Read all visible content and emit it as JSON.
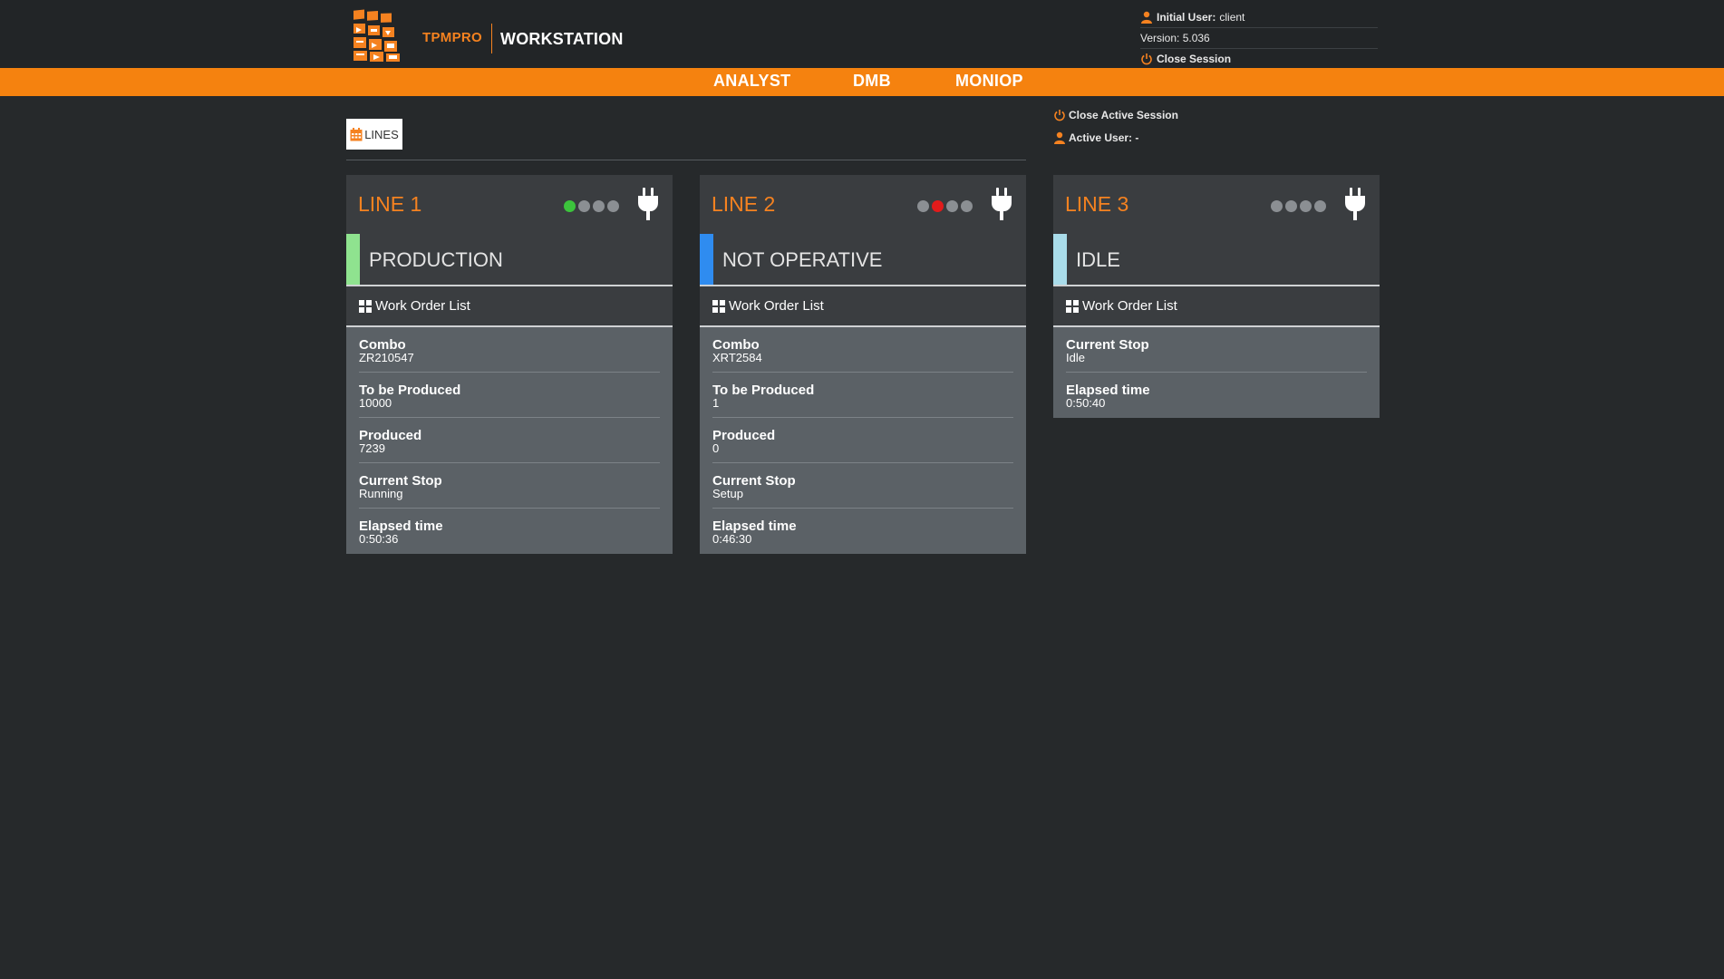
{
  "header": {
    "brand": "TPMPRO",
    "title": "WORKSTATION",
    "initial_user_label": "Initial User:",
    "initial_user_value": "client",
    "version": "Version: 5.036",
    "close_session": "Close Session"
  },
  "nav": {
    "analyst": "ANALYST",
    "dmb": "DMB",
    "moniop": "MONIOP"
  },
  "toolbar": {
    "lines_label": "LINES"
  },
  "session": {
    "close_active": "Close Active Session",
    "active_user": "Active User: -"
  },
  "colors": {
    "accent": "#f5821f",
    "status_production": "#8fe38f",
    "status_not_operative": "#2f8cf0",
    "status_idle": "#a9dcea",
    "dot_green": "#3cc43c",
    "dot_red": "#e21b1b",
    "dot_grey": "#8b8f93"
  },
  "lines": [
    {
      "name": "LINE 1",
      "status": "PRODUCTION",
      "work_order_label": "Work Order List",
      "dots": [
        "green",
        "grey",
        "grey",
        "grey"
      ],
      "fields": [
        {
          "label": "Combo",
          "value": "ZR210547"
        },
        {
          "label": "To be Produced",
          "value": "10000"
        },
        {
          "label": "Produced",
          "value": "7239"
        },
        {
          "label": "Current Stop",
          "value": "Running"
        },
        {
          "label": "Elapsed time",
          "value": "0:50:36"
        }
      ]
    },
    {
      "name": "LINE 2",
      "status": "NOT OPERATIVE",
      "work_order_label": "Work Order List",
      "dots": [
        "grey",
        "red",
        "grey",
        "grey"
      ],
      "fields": [
        {
          "label": "Combo",
          "value": "XRT2584"
        },
        {
          "label": "To be Produced",
          "value": "1"
        },
        {
          "label": "Produced",
          "value": "0"
        },
        {
          "label": "Current Stop",
          "value": "Setup"
        },
        {
          "label": "Elapsed time",
          "value": "0:46:30"
        }
      ]
    },
    {
      "name": "LINE 3",
      "status": "IDLE",
      "work_order_label": "Work Order List",
      "dots": [
        "grey",
        "grey",
        "grey",
        "grey"
      ],
      "fields": [
        {
          "label": "Current Stop",
          "value": "Idle"
        },
        {
          "label": "Elapsed time",
          "value": "0:50:40"
        }
      ]
    }
  ]
}
